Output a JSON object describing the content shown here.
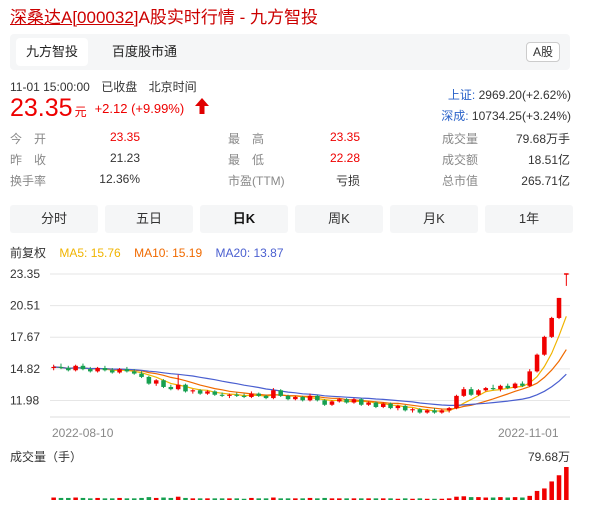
{
  "page_title": {
    "name_code_link": "深桑达A[000032]",
    "rest": "A股实时行情 - 九方智投"
  },
  "tabs": [
    {
      "label": "九方智投",
      "active": true
    },
    {
      "label": "百度股市通",
      "active": false
    }
  ],
  "market_badge": "A股",
  "status": {
    "datetime": "11-01 15:00:00",
    "state": "已收盘",
    "timezone": "北京时间"
  },
  "quote": {
    "price": "23.35",
    "unit": "元",
    "change": "+2.12 (+9.99%)",
    "arrow_icon": "up-arrow-icon",
    "color": "#e00000"
  },
  "indices": [
    {
      "label": "上证:",
      "value": "2969.20(+2.62%)"
    },
    {
      "label": "深成:",
      "value": "10734.25(+3.24%)"
    }
  ],
  "stats": [
    [
      {
        "label": "今　开",
        "value": "23.35",
        "tone": "red"
      },
      {
        "label": "最　高",
        "value": "23.35",
        "tone": "red"
      },
      {
        "label": "成交量",
        "value": "79.68万手",
        "tone": "blk"
      }
    ],
    [
      {
        "label": "昨　收",
        "value": "21.23",
        "tone": "blk"
      },
      {
        "label": "最　低",
        "value": "22.28",
        "tone": "red"
      },
      {
        "label": "成交额",
        "value": "18.51亿",
        "tone": "blk"
      }
    ],
    [
      {
        "label": "换手率",
        "value": "12.36%",
        "tone": "blk"
      },
      {
        "label": "市盈(TTM)",
        "value": "亏损",
        "tone": "blk"
      },
      {
        "label": "总市值",
        "value": "265.71亿",
        "tone": "blk"
      }
    ]
  ],
  "periods": [
    {
      "label": "分时",
      "active": false
    },
    {
      "label": "五日",
      "active": false
    },
    {
      "label": "日K",
      "active": true
    },
    {
      "label": "周K",
      "active": false
    },
    {
      "label": "月K",
      "active": false
    },
    {
      "label": "1年",
      "active": false
    }
  ],
  "ma_legend": {
    "adjust": "前复权",
    "ma5": "MA5: 15.76",
    "ma10": "MA10: 15.19",
    "ma20": "MA20: 13.87",
    "colors": {
      "ma5": "#f0b400",
      "ma10": "#f06a00",
      "ma20": "#4a5fd0"
    }
  },
  "colors": {
    "up": "#f00000",
    "down": "#16a050",
    "grid": "#e6e6e6"
  },
  "chart_data": {
    "type": "candlestick",
    "y_ticks": [
      "23.35",
      "20.51",
      "17.67",
      "14.82",
      "11.98"
    ],
    "ylim": [
      10.5,
      23.35
    ],
    "x_labels": [
      "2022-08-10",
      "2022-11-01"
    ],
    "volume_label": "成交量（手）",
    "volume_max_label": "79.68万",
    "candles": [
      {
        "o": 14.9,
        "h": 15.2,
        "l": 14.7,
        "c": 15.0
      },
      {
        "o": 15.0,
        "h": 15.3,
        "l": 14.8,
        "c": 14.9
      },
      {
        "o": 14.9,
        "h": 15.1,
        "l": 14.6,
        "c": 14.7
      },
      {
        "o": 14.7,
        "h": 15.2,
        "l": 14.6,
        "c": 15.1
      },
      {
        "o": 15.1,
        "h": 15.3,
        "l": 14.7,
        "c": 14.8
      },
      {
        "o": 14.8,
        "h": 15.0,
        "l": 14.5,
        "c": 14.6
      },
      {
        "o": 14.6,
        "h": 15.0,
        "l": 14.5,
        "c": 14.9
      },
      {
        "o": 14.9,
        "h": 15.1,
        "l": 14.6,
        "c": 14.7
      },
      {
        "o": 14.7,
        "h": 14.9,
        "l": 14.4,
        "c": 14.5
      },
      {
        "o": 14.5,
        "h": 14.9,
        "l": 14.4,
        "c": 14.8
      },
      {
        "o": 14.8,
        "h": 15.0,
        "l": 14.5,
        "c": 14.6
      },
      {
        "o": 14.6,
        "h": 14.8,
        "l": 14.3,
        "c": 14.4
      },
      {
        "o": 14.4,
        "h": 14.6,
        "l": 14.0,
        "c": 14.1
      },
      {
        "o": 14.1,
        "h": 14.2,
        "l": 13.4,
        "c": 13.5
      },
      {
        "o": 13.5,
        "h": 13.9,
        "l": 13.3,
        "c": 13.8
      },
      {
        "o": 13.8,
        "h": 13.9,
        "l": 13.1,
        "c": 13.2
      },
      {
        "o": 13.2,
        "h": 13.4,
        "l": 12.9,
        "c": 13.0
      },
      {
        "o": 13.0,
        "h": 14.3,
        "l": 12.9,
        "c": 13.4
      },
      {
        "o": 13.4,
        "h": 13.5,
        "l": 12.7,
        "c": 12.8
      },
      {
        "o": 12.8,
        "h": 13.0,
        "l": 12.6,
        "c": 12.9
      },
      {
        "o": 12.9,
        "h": 13.0,
        "l": 12.5,
        "c": 12.6
      },
      {
        "o": 12.6,
        "h": 12.9,
        "l": 12.5,
        "c": 12.8
      },
      {
        "o": 12.8,
        "h": 12.9,
        "l": 12.4,
        "c": 12.5
      },
      {
        "o": 12.5,
        "h": 12.7,
        "l": 12.3,
        "c": 12.4
      },
      {
        "o": 12.4,
        "h": 12.6,
        "l": 12.2,
        "c": 12.5
      },
      {
        "o": 12.5,
        "h": 12.7,
        "l": 12.3,
        "c": 12.4
      },
      {
        "o": 12.4,
        "h": 12.6,
        "l": 12.2,
        "c": 12.3
      },
      {
        "o": 12.3,
        "h": 12.8,
        "l": 12.2,
        "c": 12.6
      },
      {
        "o": 12.6,
        "h": 12.7,
        "l": 12.3,
        "c": 12.4
      },
      {
        "o": 12.4,
        "h": 12.5,
        "l": 12.1,
        "c": 12.2
      },
      {
        "o": 12.2,
        "h": 13.1,
        "l": 12.1,
        "c": 12.9
      },
      {
        "o": 12.9,
        "h": 13.0,
        "l": 12.3,
        "c": 12.4
      },
      {
        "o": 12.4,
        "h": 12.5,
        "l": 12.0,
        "c": 12.1
      },
      {
        "o": 12.1,
        "h": 12.4,
        "l": 12.0,
        "c": 12.3
      },
      {
        "o": 12.3,
        "h": 12.4,
        "l": 11.9,
        "c": 12.0
      },
      {
        "o": 12.0,
        "h": 12.6,
        "l": 11.9,
        "c": 12.4
      },
      {
        "o": 12.4,
        "h": 12.5,
        "l": 11.9,
        "c": 12.0
      },
      {
        "o": 12.0,
        "h": 12.1,
        "l": 11.5,
        "c": 11.6
      },
      {
        "o": 11.6,
        "h": 12.0,
        "l": 11.5,
        "c": 11.9
      },
      {
        "o": 11.9,
        "h": 12.2,
        "l": 11.8,
        "c": 12.1
      },
      {
        "o": 12.1,
        "h": 12.2,
        "l": 11.7,
        "c": 11.8
      },
      {
        "o": 11.8,
        "h": 12.2,
        "l": 11.7,
        "c": 12.1
      },
      {
        "o": 12.1,
        "h": 12.2,
        "l": 11.5,
        "c": 11.6
      },
      {
        "o": 11.6,
        "h": 11.9,
        "l": 11.5,
        "c": 11.8
      },
      {
        "o": 11.8,
        "h": 11.9,
        "l": 11.3,
        "c": 11.4
      },
      {
        "o": 11.4,
        "h": 11.8,
        "l": 11.3,
        "c": 11.7
      },
      {
        "o": 11.7,
        "h": 11.8,
        "l": 11.2,
        "c": 11.3
      },
      {
        "o": 11.3,
        "h": 11.6,
        "l": 11.1,
        "c": 11.5
      },
      {
        "o": 11.5,
        "h": 11.6,
        "l": 11.0,
        "c": 11.1
      },
      {
        "o": 11.1,
        "h": 11.3,
        "l": 10.9,
        "c": 11.2
      },
      {
        "o": 11.2,
        "h": 11.3,
        "l": 10.8,
        "c": 10.9
      },
      {
        "o": 10.9,
        "h": 11.2,
        "l": 10.8,
        "c": 11.1
      },
      {
        "o": 11.1,
        "h": 11.3,
        "l": 10.8,
        "c": 10.9
      },
      {
        "o": 10.9,
        "h": 11.2,
        "l": 10.8,
        "c": 11.1
      },
      {
        "o": 11.1,
        "h": 11.4,
        "l": 10.9,
        "c": 11.3
      },
      {
        "o": 11.3,
        "h": 12.5,
        "l": 11.2,
        "c": 12.4
      },
      {
        "o": 12.4,
        "h": 13.2,
        "l": 12.3,
        "c": 13.0
      },
      {
        "o": 13.0,
        "h": 13.2,
        "l": 12.4,
        "c": 12.5
      },
      {
        "o": 12.5,
        "h": 13.0,
        "l": 12.4,
        "c": 12.9
      },
      {
        "o": 12.9,
        "h": 13.2,
        "l": 12.8,
        "c": 13.1
      },
      {
        "o": 13.1,
        "h": 13.4,
        "l": 12.9,
        "c": 13.0
      },
      {
        "o": 13.0,
        "h": 13.4,
        "l": 12.8,
        "c": 13.3
      },
      {
        "o": 13.3,
        "h": 13.5,
        "l": 13.0,
        "c": 13.1
      },
      {
        "o": 13.1,
        "h": 13.6,
        "l": 13.0,
        "c": 13.5
      },
      {
        "o": 13.5,
        "h": 13.7,
        "l": 13.2,
        "c": 13.3
      },
      {
        "o": 13.3,
        "h": 14.8,
        "l": 13.2,
        "c": 14.6
      },
      {
        "o": 14.6,
        "h": 16.2,
        "l": 14.5,
        "c": 16.1
      },
      {
        "o": 16.1,
        "h": 17.8,
        "l": 16.0,
        "c": 17.7
      },
      {
        "o": 17.7,
        "h": 19.5,
        "l": 17.6,
        "c": 19.4
      },
      {
        "o": 19.4,
        "h": 21.2,
        "l": 19.3,
        "c": 21.2
      },
      {
        "o": 23.35,
        "h": 23.35,
        "l": 22.28,
        "c": 23.35
      }
    ],
    "volume": [
      6,
      5,
      5,
      6,
      5,
      4,
      5,
      4,
      4,
      5,
      4,
      4,
      5,
      7,
      5,
      6,
      5,
      8,
      5,
      4,
      4,
      4,
      4,
      4,
      4,
      4,
      3,
      5,
      4,
      4,
      6,
      4,
      4,
      4,
      4,
      5,
      4,
      5,
      4,
      4,
      4,
      4,
      4,
      4,
      4,
      4,
      4,
      3,
      4,
      3,
      4,
      3,
      3,
      3,
      4,
      8,
      9,
      7,
      7,
      6,
      6,
      7,
      6,
      7,
      6,
      10,
      22,
      28,
      45,
      60,
      80
    ]
  }
}
